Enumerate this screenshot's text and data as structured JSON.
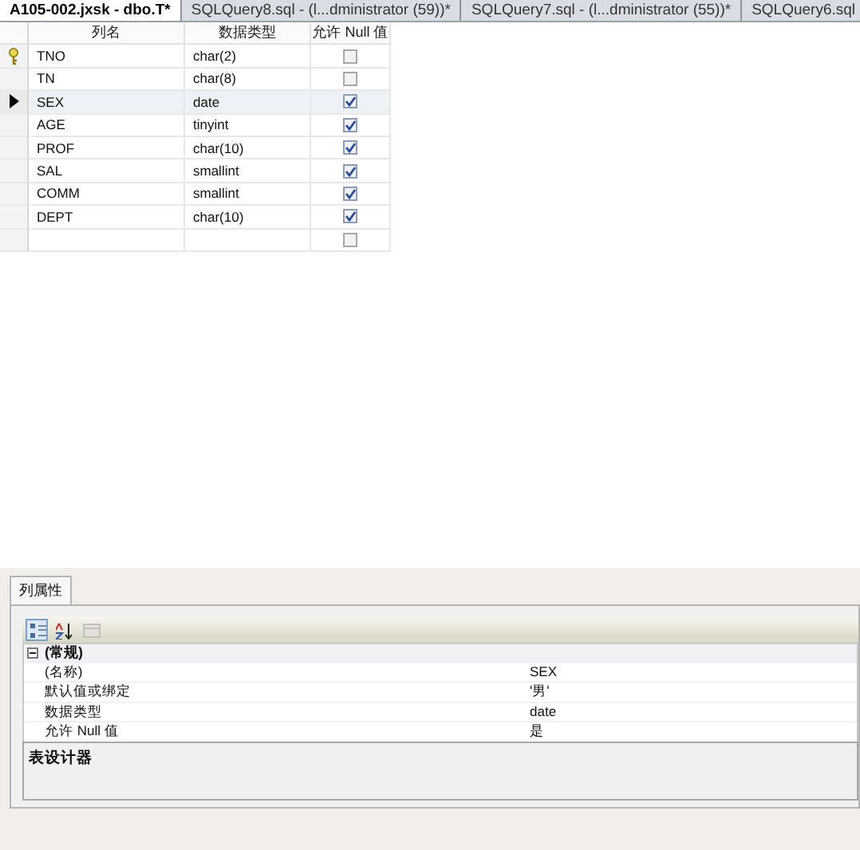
{
  "tabs": [
    {
      "label": "A105-002.jxsk - dbo.T*",
      "selected": true
    },
    {
      "label": "SQLQuery8.sql - (l...dministrator (59))*",
      "selected": false
    },
    {
      "label": "SQLQuery7.sql - (l...dministrator (55))*",
      "selected": false
    },
    {
      "label": "SQLQuery6.sql",
      "selected": false
    }
  ],
  "table": {
    "columns": [
      "列名",
      "数据类型",
      "允许 Null 值"
    ],
    "rows": [
      {
        "name": "TNO",
        "type": "char(2)",
        "allow_null": false,
        "primary_key": true,
        "selected": false
      },
      {
        "name": "TN",
        "type": "char(8)",
        "allow_null": false,
        "primary_key": false,
        "selected": false
      },
      {
        "name": "SEX",
        "type": "date",
        "allow_null": true,
        "primary_key": false,
        "selected": true
      },
      {
        "name": "AGE",
        "type": "tinyint",
        "allow_null": true,
        "primary_key": false,
        "selected": false
      },
      {
        "name": "PROF",
        "type": "char(10)",
        "allow_null": true,
        "primary_key": false,
        "selected": false
      },
      {
        "name": "SAL",
        "type": "smallint",
        "allow_null": true,
        "primary_key": false,
        "selected": false
      },
      {
        "name": "COMM",
        "type": "smallint",
        "allow_null": true,
        "primary_key": false,
        "selected": false
      },
      {
        "name": "DEPT",
        "type": "char(10)",
        "allow_null": true,
        "primary_key": false,
        "selected": false
      },
      {
        "allow_null": false,
        "primary_key": false,
        "selected": false
      }
    ]
  },
  "properties_panel": {
    "tab": "列属性",
    "toolbar": [
      {
        "kind": "categorized",
        "selected": true,
        "disabled": false
      },
      {
        "kind": "alphabetical",
        "selected": false,
        "disabled": false
      },
      {
        "kind": "pages",
        "selected": false,
        "disabled": true
      }
    ],
    "group": {
      "title": "(常规)",
      "expanded": true,
      "items": [
        {
          "name": "(名称)",
          "value": "SEX"
        },
        {
          "name": "默认值或绑定",
          "value": "'男'"
        },
        {
          "name": "数据类型",
          "value": "date"
        },
        {
          "name": "允许 Null 值",
          "value": "是"
        }
      ]
    },
    "description": "表设计器"
  }
}
